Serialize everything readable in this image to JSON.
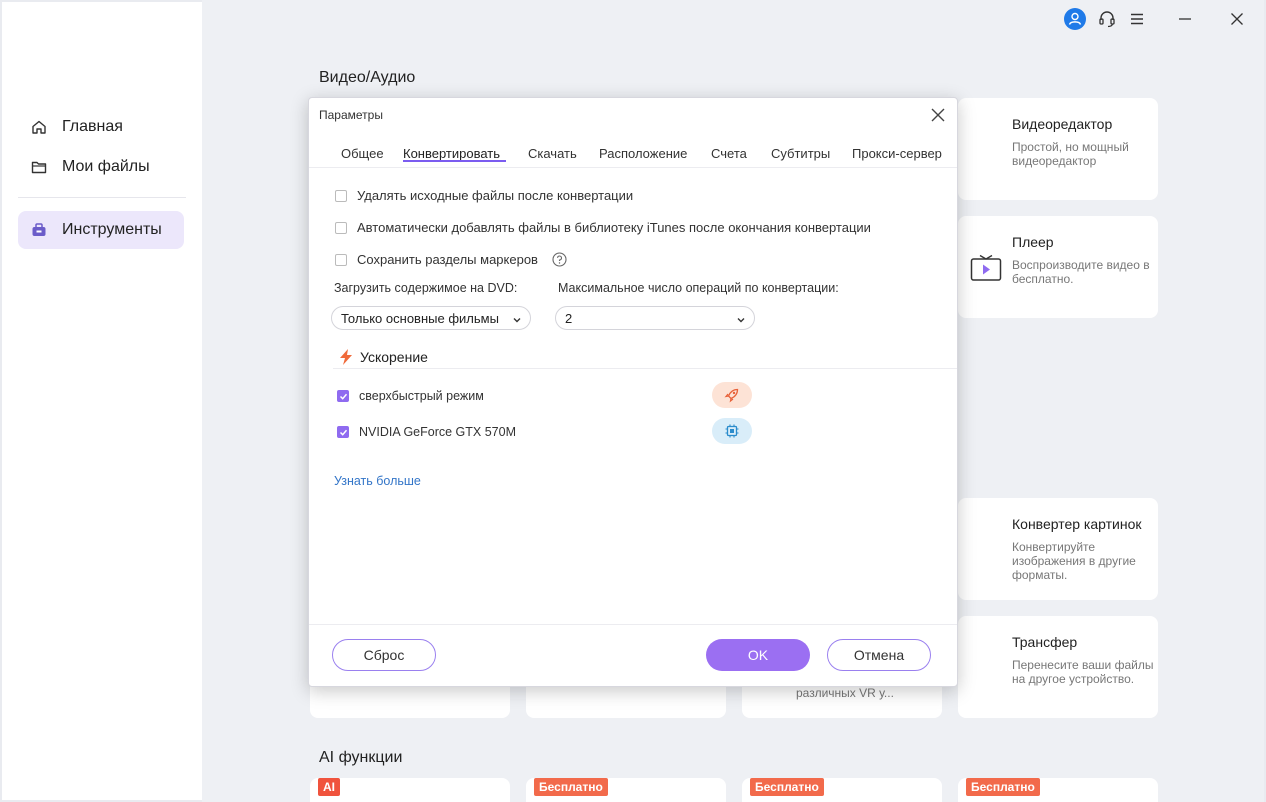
{
  "sidebar": {
    "items": [
      {
        "label": "Главная",
        "icon": "home-icon"
      },
      {
        "label": "Мои файлы",
        "icon": "folder-icon"
      },
      {
        "label": "Инструменты",
        "icon": "toolbox-icon"
      }
    ]
  },
  "main": {
    "section_video": "Видео/Аудио",
    "section_ai": "AI функции",
    "cards": [
      {
        "title": "Видеоредактор",
        "desc": "Простой, но мощный видеоредактор"
      },
      {
        "title": "Плеер",
        "desc": "Воспроизводите видео в бесплатно."
      },
      {
        "title": "Конвертер картинок",
        "desc": "Конвертируйте изображения в другие форматы."
      },
      {
        "title": "Трансфер",
        "desc": "Перенесите ваши файлы на другое устройство."
      }
    ],
    "partial_card_text": "различных VR у...",
    "badges": [
      "AI",
      "Бесплатно",
      "Бесплатно",
      "Бесплатно"
    ]
  },
  "dialog": {
    "title": "Параметры",
    "tabs": [
      "Общее",
      "Конвертировать",
      "Скачать",
      "Расположение",
      "Счета",
      "Субтитры",
      "Прокси-сервер"
    ],
    "active_tab": "Конвертировать",
    "options": [
      {
        "label": "Удалять исходные файлы после конвертации",
        "checked": false
      },
      {
        "label": "Автоматически добавлять файлы в библиотеку iTunes после окончания конвертации",
        "checked": false
      },
      {
        "label": "Сохранить разделы маркеров",
        "checked": false
      }
    ],
    "dvd_label": "Загрузить содержимое на DVD:",
    "dvd_value": "Только основные фильмы",
    "max_ops_label": "Максимальное число операций по конвертации:",
    "max_ops_value": "2",
    "accel_title": "Ускорение",
    "accel_options": [
      {
        "label": "сверхбыстрый режим",
        "checked": true,
        "icon": "rocket-icon"
      },
      {
        "label": "NVIDIA GeForce GTX 570M",
        "checked": true,
        "icon": "chip-icon"
      }
    ],
    "learn_more": "Узнать больше",
    "reset_label": "Сброс",
    "ok_label": "OK",
    "cancel_label": "Отмена"
  },
  "colors": {
    "accent": "#8f6bf0",
    "link": "#3375c8",
    "badge_ai": "#f0533d",
    "badge_free": "#f26a4b"
  }
}
